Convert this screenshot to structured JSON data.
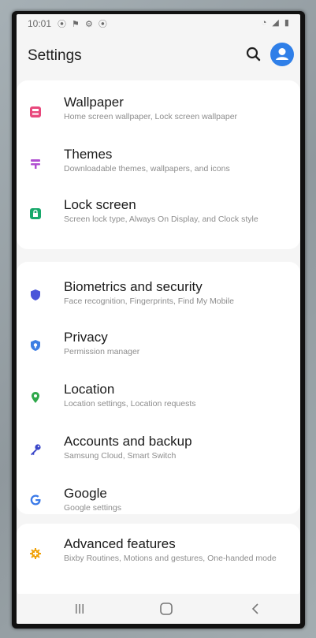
{
  "status": {
    "time": "10:01",
    "left_icons": "⦿ ⚑ ⚙ ⦿",
    "right_icons": "◔ ◢ ▮"
  },
  "header": {
    "title": "Settings"
  },
  "groups": [
    {
      "items": [
        {
          "title": "Wallpaper",
          "subtitle": "Home screen wallpaper, Lock screen wallpaper",
          "icon": "wallpaper-icon",
          "color": "#e8487c"
        },
        {
          "title": "Themes",
          "subtitle": "Downloadable themes, wallpapers, and icons",
          "icon": "themes-icon",
          "color": "#b04fd1"
        },
        {
          "title": "Lock screen",
          "subtitle": "Screen lock type, Always On Display, and Clock style",
          "icon": "lock-icon",
          "color": "#18a86b"
        }
      ]
    },
    {
      "items": [
        {
          "title": "Biometrics and security",
          "subtitle": "Face recognition, Fingerprints, Find My Mobile",
          "icon": "shield-icon",
          "color": "#4a55d9"
        },
        {
          "title": "Privacy",
          "subtitle": "Permission manager",
          "icon": "privacy-icon",
          "color": "#3d7fe3"
        },
        {
          "title": "Location",
          "subtitle": "Location settings, Location requests",
          "icon": "location-pin-icon",
          "color": "#2fa84b"
        },
        {
          "title": "Accounts and backup",
          "subtitle": "Samsung Cloud, Smart Switch",
          "icon": "key-icon",
          "color": "#3a46c9"
        },
        {
          "title": "Google",
          "subtitle": "Google settings",
          "icon": "google-icon",
          "color": "#3b7ae8"
        }
      ]
    },
    {
      "items": [
        {
          "title": "Advanced features",
          "subtitle": "Bixby Routines, Motions and gestures, One-handed mode",
          "icon": "gear-plus-icon",
          "color": "#f0a20a"
        }
      ]
    }
  ],
  "nav": {
    "recent": "recent-apps-icon",
    "home": "home-icon",
    "back": "back-icon"
  }
}
